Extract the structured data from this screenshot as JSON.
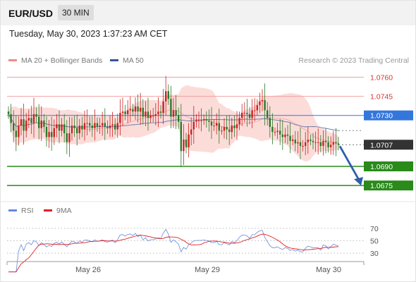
{
  "header": {
    "pair": "EUR/USD",
    "timeframe": "30 MIN"
  },
  "timestamp": "Tuesday, May 30, 2023 1:37:23 AM CET",
  "credit": "Research © 2023 Trading Central",
  "colors": {
    "candle_up": "#cc2222",
    "candle_down": "#2a7a2a",
    "ma50": "#6677aa",
    "band_fill": "#fbd0cc",
    "resistance": "#f2a0a0",
    "pivot": "#3377dd",
    "support": "#2a8a1a",
    "current": "#333333",
    "arrow": "#2e5fa8",
    "rsi": "#6688dd",
    "rsi_ma": "#e02020"
  },
  "chart_data": [
    {
      "type": "candlestick",
      "legend": [
        {
          "name": "MA 20 + Bollinger Bands",
          "color": "#f08a8a"
        },
        {
          "name": "MA 50",
          "color": "#335599"
        }
      ],
      "x_ticks": [
        "May 26",
        "May 29",
        "May 30"
      ],
      "ylim": [
        1.0664,
        1.0768
      ],
      "levels": [
        {
          "value": 1.076,
          "label": "1.0760",
          "kind": "resistance"
        },
        {
          "value": 1.0745,
          "label": "1.0745",
          "kind": "resistance"
        },
        {
          "value": 1.073,
          "label": "1.0730",
          "kind": "pivot"
        },
        {
          "value": 1.0707,
          "label": "1.0707",
          "kind": "current"
        },
        {
          "value": 1.069,
          "label": "1.0690",
          "kind": "support"
        },
        {
          "value": 1.0675,
          "label": "1.0675",
          "kind": "support"
        }
      ],
      "closes": [
        1.0731,
        1.0724,
        1.0718,
        1.0713,
        1.0722,
        1.0727,
        1.0718,
        1.0726,
        1.0728,
        1.0724,
        1.0731,
        1.0729,
        1.072,
        1.0726,
        1.0721,
        1.0713,
        1.0717,
        1.0713,
        1.072,
        1.0723,
        1.0718,
        1.0723,
        1.0716,
        1.0709,
        1.0716,
        1.0722,
        1.072,
        1.0716,
        1.0722,
        1.0719,
        1.0724,
        1.0724,
        1.0722,
        1.072,
        1.0724,
        1.0721,
        1.0722,
        1.0724,
        1.0721,
        1.072,
        1.0722,
        1.0723,
        1.0719,
        1.0724,
        1.0732,
        1.0733,
        1.0731,
        1.0734,
        1.0735,
        1.0733,
        1.0737,
        1.0733,
        1.0736,
        1.0729,
        1.0733,
        1.0728,
        1.073,
        1.073,
        1.0731,
        1.0733,
        1.0732,
        1.0741,
        1.0749,
        1.0743,
        1.0729,
        1.0734,
        1.073,
        1.0725,
        1.0702,
        1.0711,
        1.0705,
        1.0715,
        1.0719,
        1.0725,
        1.0726,
        1.0726,
        1.0726,
        1.0727,
        1.0726,
        1.0725,
        1.0722,
        1.0722,
        1.0724,
        1.0718,
        1.0718,
        1.0721,
        1.0719,
        1.0717,
        1.0722,
        1.072,
        1.0723,
        1.0728,
        1.0732,
        1.0732,
        1.0731,
        1.0728,
        1.0734,
        1.0734,
        1.0738,
        1.0741,
        1.0742,
        1.0734,
        1.0728,
        1.0721,
        1.0717,
        1.0717,
        1.0718,
        1.0715,
        1.0713,
        1.0715,
        1.0714,
        1.071,
        1.0711,
        1.0708,
        1.0709,
        1.0706,
        1.0706,
        1.0709,
        1.0711,
        1.071,
        1.0709,
        1.0709,
        1.0709,
        1.0706,
        1.071,
        1.0709,
        1.0705,
        1.0707,
        1.0709,
        1.0708,
        1.0707
      ],
      "title": "",
      "xlabel": "",
      "ylabel": ""
    },
    {
      "type": "line",
      "legend": [
        {
          "name": "RSI",
          "color": "#6688dd"
        },
        {
          "name": "9MA",
          "color": "#e02020"
        }
      ],
      "y_ticks": [
        "70",
        "50",
        "30"
      ],
      "ylim": [
        20,
        80
      ],
      "title": "",
      "xlabel": "",
      "ylabel": ""
    }
  ]
}
